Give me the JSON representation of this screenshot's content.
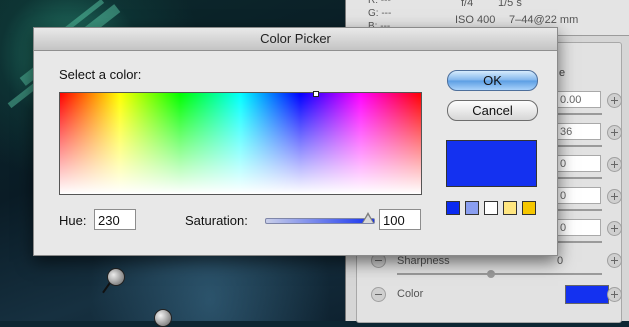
{
  "dialog": {
    "title": "Color Picker",
    "select_label": "Select a color:",
    "hue_label": "Hue:",
    "hue_value": "230",
    "saturation_label": "Saturation:",
    "saturation_value": "100",
    "saturation_level": 1.0,
    "ok_label": "OK",
    "cancel_label": "Cancel",
    "preview_color": "#1431f0",
    "recent_swatches": [
      "#0a2af0",
      "#8a9ef0",
      "#ffffff",
      "#ffe680",
      "#f5c600"
    ]
  },
  "info_panel": {
    "r_label": "R:",
    "r_value": "---",
    "g_label": "G:",
    "g_value": "---",
    "b_label": "B:",
    "b_value": "---",
    "aperture": "f/4",
    "shutter": "1/5 s",
    "iso": "ISO 400",
    "lens": "7–44@22 mm"
  },
  "adjustments": {
    "value_1": "0.00",
    "value_2": "36",
    "value_3": "0",
    "value_4": "0",
    "value_5": "0",
    "value_6": "0",
    "sharpness_label": "Sharpness",
    "sharpness_value": "0",
    "color_label": "Color",
    "color_value": "#1431f0"
  }
}
